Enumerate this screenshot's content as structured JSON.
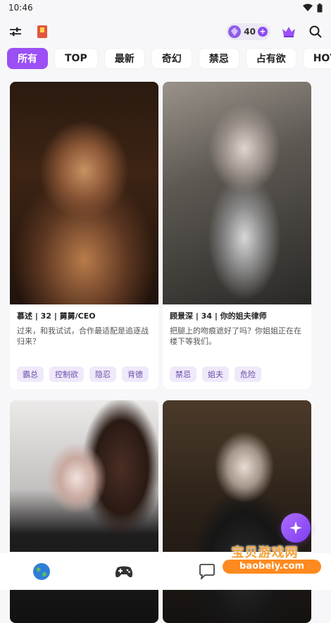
{
  "status_bar": {
    "time": "10:46"
  },
  "header": {
    "coin_count": "40"
  },
  "tabs": [
    {
      "label": "所有",
      "active": true
    },
    {
      "label": "TOP",
      "active": false
    },
    {
      "label": "最新",
      "active": false
    },
    {
      "label": "奇幻",
      "active": false
    },
    {
      "label": "禁忌",
      "active": false
    },
    {
      "label": "占有欲",
      "active": false
    },
    {
      "label": "HOT",
      "active": false
    }
  ],
  "cards": [
    {
      "title": "慕述 | 32 | 舅舅/CEO",
      "desc": "过来，和我试试，合作最适配是追逐战归来？",
      "tags": [
        "霸总",
        "控制欲",
        "隐忍",
        "背德"
      ]
    },
    {
      "title": "顾景深 | 34 | 你的姐夫律师",
      "desc": "把腿上的吻痕遮好了吗？你姐姐正在在楼下等我们。",
      "tags": [
        "禁忌",
        "姐夫",
        "危险"
      ]
    },
    {
      "title": "",
      "desc": "",
      "tags": []
    },
    {
      "title": "",
      "desc": "",
      "tags": []
    }
  ],
  "watermark": {
    "title": "宝贝游戏网",
    "url": "baobeiy.com"
  },
  "colors": {
    "accent": "#9b4ff5",
    "tag_bg": "#efe9fa",
    "tag_text": "#6a4ea8"
  }
}
